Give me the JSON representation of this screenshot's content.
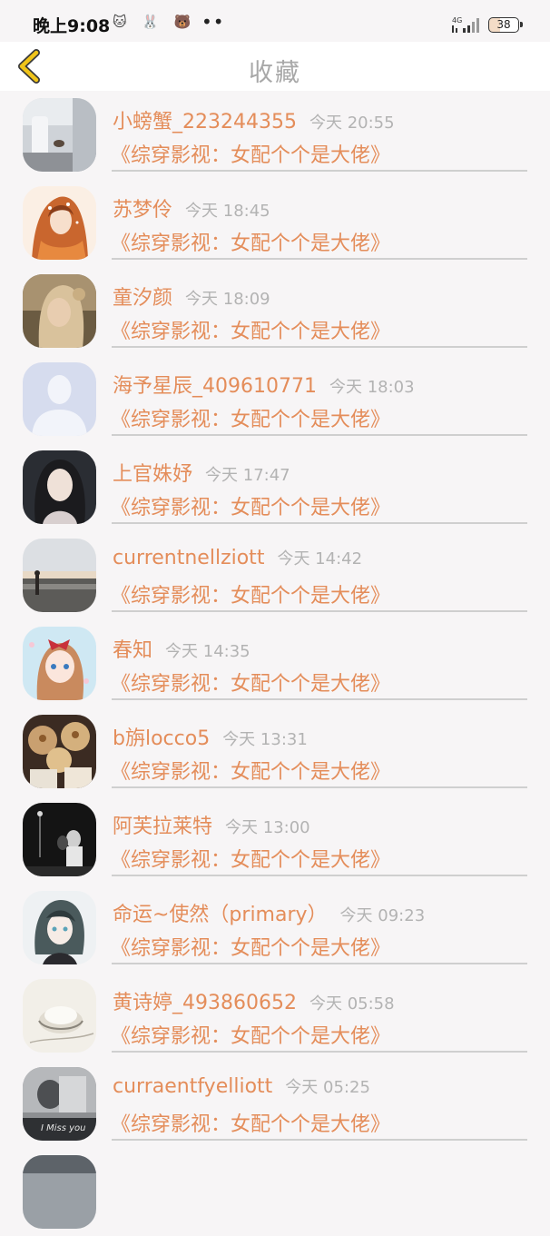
{
  "status_bar": {
    "time": "晚上9:08",
    "left_icons": "🐱 🐰 🐻",
    "dots": "••",
    "signal_label": "4G",
    "battery": "38"
  },
  "header": {
    "title": "收藏",
    "back_icon": "chevron-left-icon",
    "accent_color": "#f0c419"
  },
  "colors": {
    "name": "#e48d5a",
    "time": "#b3b3b3",
    "divider": "#cfcfcf"
  },
  "items": [
    {
      "name": "小螃蟹_223244355",
      "time": "今天 20:55",
      "book": "《综穿影视：女配个个是大佬》",
      "avatar": "photo-bottle"
    },
    {
      "name": "苏梦伶",
      "time": "今天 18:45",
      "book": "《综穿影视：女配个个是大佬》",
      "avatar": "illustration-girl-orange"
    },
    {
      "name": "童汐颜",
      "time": "今天 18:09",
      "book": "《综穿影视：女配个个是大佬》",
      "avatar": "photo-girl-blonde"
    },
    {
      "name": "海予星辰_409610771",
      "time": "今天 18:03",
      "book": "《综穿影视：女配个个是大佬》",
      "avatar": "default-user"
    },
    {
      "name": "上官姝妤",
      "time": "今天 17:47",
      "book": "《综穿影视：女配个个是大佬》",
      "avatar": "photo-girl-dark"
    },
    {
      "name": "currentnellziott",
      "time": "今天 14:42",
      "book": "《综穿影视：女配个个是大佬》",
      "avatar": "photo-beach"
    },
    {
      "name": "春知",
      "time": "今天 14:35",
      "book": "《综穿影视：女配个个是大佬》",
      "avatar": "illustration-girl-bow"
    },
    {
      "name": "b旃locco5",
      "time": "今天 13:31",
      "book": "《综穿影视：女配个个是大佬》",
      "avatar": "photo-desserts"
    },
    {
      "name": "阿芙拉莱特",
      "time": "今天 13:00",
      "book": "《综穿影视：女配个个是大佬》",
      "avatar": "photo-night-couple"
    },
    {
      "name": "命运~使然（primary）",
      "time": "今天 09:23",
      "book": "《综穿影视：女配个个是大佬》",
      "avatar": "illustration-anime-boy"
    },
    {
      "name": "黄诗婷_493860652",
      "time": "今天 05:58",
      "book": "《综穿影视：女配个个是大佬》",
      "avatar": "sketch-bowl"
    },
    {
      "name": "curraentfyelliott",
      "time": "今天 05:25",
      "book": "《综穿影视：女配个个是大佬》",
      "avatar": "photo-miss-you"
    }
  ],
  "avatar_caption": "I Miss you"
}
